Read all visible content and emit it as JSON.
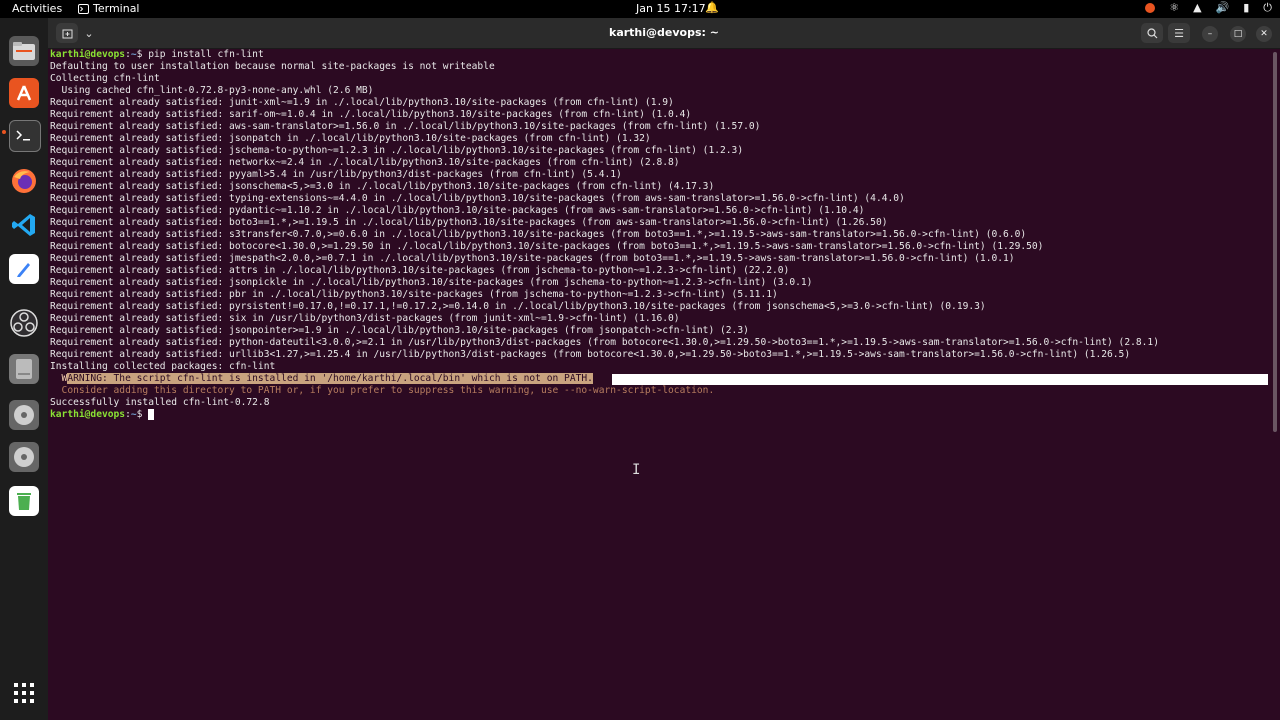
{
  "topbar": {
    "activities": "Activities",
    "app_name": "Terminal",
    "clock": "Jan 15  17:17"
  },
  "dock": {
    "items": [
      "files-icon",
      "app-center-icon",
      "terminal-icon",
      "firefox-icon",
      "vscode-icon",
      "text-editor-icon",
      "obs-icon",
      "drive-icon",
      "disc-icon",
      "disc-icon-2",
      "trash-icon",
      "show-apps-icon"
    ]
  },
  "window": {
    "title": "karthi@devops: ~"
  },
  "terminal": {
    "user": "karthi@devops",
    "path": "~",
    "prompt_suffix": "$ ",
    "command": "pip install cfn-lint",
    "output": [
      "Defaulting to user installation because normal site-packages is not writeable",
      "Collecting cfn-lint",
      "  Using cached cfn_lint-0.72.8-py3-none-any.whl (2.6 MB)",
      "Requirement already satisfied: junit-xml~=1.9 in ./.local/lib/python3.10/site-packages (from cfn-lint) (1.9)",
      "Requirement already satisfied: sarif-om~=1.0.4 in ./.local/lib/python3.10/site-packages (from cfn-lint) (1.0.4)",
      "Requirement already satisfied: aws-sam-translator>=1.56.0 in ./.local/lib/python3.10/site-packages (from cfn-lint) (1.57.0)",
      "Requirement already satisfied: jsonpatch in ./.local/lib/python3.10/site-packages (from cfn-lint) (1.32)",
      "Requirement already satisfied: jschema-to-python~=1.2.3 in ./.local/lib/python3.10/site-packages (from cfn-lint) (1.2.3)",
      "Requirement already satisfied: networkx~=2.4 in ./.local/lib/python3.10/site-packages (from cfn-lint) (2.8.8)",
      "Requirement already satisfied: pyyaml>5.4 in /usr/lib/python3/dist-packages (from cfn-lint) (5.4.1)",
      "Requirement already satisfied: jsonschema<5,>=3.0 in ./.local/lib/python3.10/site-packages (from cfn-lint) (4.17.3)",
      "Requirement already satisfied: typing-extensions~=4.4.0 in ./.local/lib/python3.10/site-packages (from aws-sam-translator>=1.56.0->cfn-lint) (4.4.0)",
      "Requirement already satisfied: pydantic~=1.10.2 in ./.local/lib/python3.10/site-packages (from aws-sam-translator>=1.56.0->cfn-lint) (1.10.4)",
      "Requirement already satisfied: boto3==1.*,>=1.19.5 in ./.local/lib/python3.10/site-packages (from aws-sam-translator>=1.56.0->cfn-lint) (1.26.50)",
      "Requirement already satisfied: s3transfer<0.7.0,>=0.6.0 in ./.local/lib/python3.10/site-packages (from boto3==1.*,>=1.19.5->aws-sam-translator>=1.56.0->cfn-lint) (0.6.0)",
      "Requirement already satisfied: botocore<1.30.0,>=1.29.50 in ./.local/lib/python3.10/site-packages (from boto3==1.*,>=1.19.5->aws-sam-translator>=1.56.0->cfn-lint) (1.29.50)",
      "Requirement already satisfied: jmespath<2.0.0,>=0.7.1 in ./.local/lib/python3.10/site-packages (from boto3==1.*,>=1.19.5->aws-sam-translator>=1.56.0->cfn-lint) (1.0.1)",
      "Requirement already satisfied: attrs in ./.local/lib/python3.10/site-packages (from jschema-to-python~=1.2.3->cfn-lint) (22.2.0)",
      "Requirement already satisfied: jsonpickle in ./.local/lib/python3.10/site-packages (from jschema-to-python~=1.2.3->cfn-lint) (3.0.1)",
      "Requirement already satisfied: pbr in ./.local/lib/python3.10/site-packages (from jschema-to-python~=1.2.3->cfn-lint) (5.11.1)",
      "Requirement already satisfied: pyrsistent!=0.17.0,!=0.17.1,!=0.17.2,>=0.14.0 in ./.local/lib/python3.10/site-packages (from jsonschema<5,>=3.0->cfn-lint) (0.19.3)",
      "Requirement already satisfied: six in /usr/lib/python3/dist-packages (from junit-xml~=1.9->cfn-lint) (1.16.0)",
      "Requirement already satisfied: jsonpointer>=1.9 in ./.local/lib/python3.10/site-packages (from jsonpatch->cfn-lint) (2.3)",
      "Requirement already satisfied: python-dateutil<3.0.0,>=2.1 in /usr/lib/python3/dist-packages (from botocore<1.30.0,>=1.29.50->boto3==1.*,>=1.19.5->aws-sam-translator>=1.56.0->cfn-lint) (2.8.1)",
      "Requirement already satisfied: urllib3<1.27,>=1.25.4 in /usr/lib/python3/dist-packages (from botocore<1.30.0,>=1.29.50->boto3==1.*,>=1.19.5->aws-sam-translator>=1.56.0->cfn-lint) (1.26.5)",
      "Installing collected packages: cfn-lint"
    ],
    "warning_prefix": "  W",
    "warning_highlight": "ARNING: The script cfn-lint is installed in '/home/karthi/.local/bin' which is not on PATH.",
    "warning_hint": "  Consider adding this directory to PATH or, if you prefer to suppress this warning, use --no-warn-script-location.",
    "success": "Successfully installed cfn-lint-0.72.8"
  }
}
